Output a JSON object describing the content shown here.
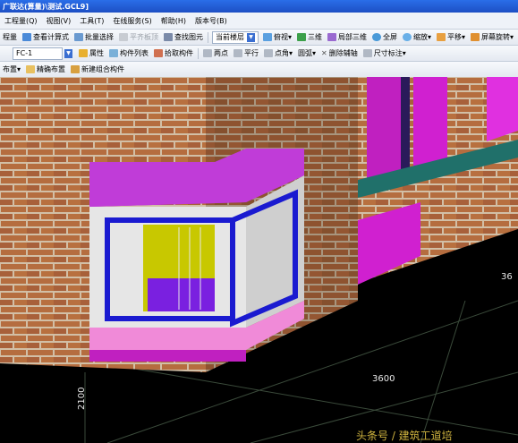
{
  "window": {
    "title": "广联达(算量)\\测试.GCL9]"
  },
  "menu": [
    "工程量(Q)",
    "视图(V)",
    "工具(T)",
    "在线服务(S)",
    "帮助(H)",
    "版本号(B)"
  ],
  "toolbar1": {
    "items": [
      "程量",
      "查看计算式",
      "批量选择",
      "平齐板顶",
      "查找图元"
    ],
    "floor_dropdown": "当前楼层",
    "view_items": [
      "俯视",
      "三维",
      "局部三维",
      "全屏",
      "缩放",
      "平移",
      "屏幕旋转"
    ]
  },
  "toolbar2": {
    "component_dropdown": "FC-1",
    "items": [
      "属性",
      "构件列表",
      "拾取构件",
      "两点",
      "平行",
      "点角",
      "圆弧",
      "删除辅轴",
      "尺寸标注"
    ]
  },
  "toolbar3": {
    "items": [
      "布置",
      "精确布置",
      "新建组合构件"
    ]
  },
  "viewport": {
    "dimensions": [
      "36",
      "3600",
      "2100"
    ],
    "watermark": "头条号 / 建筑工道培"
  },
  "colors": {
    "brick": "#b06a3e",
    "mortar": "#d9c7b0",
    "frame_blue": "#1a1ad0",
    "magenta": "#d020d0",
    "pink": "#f08ad8"
  }
}
